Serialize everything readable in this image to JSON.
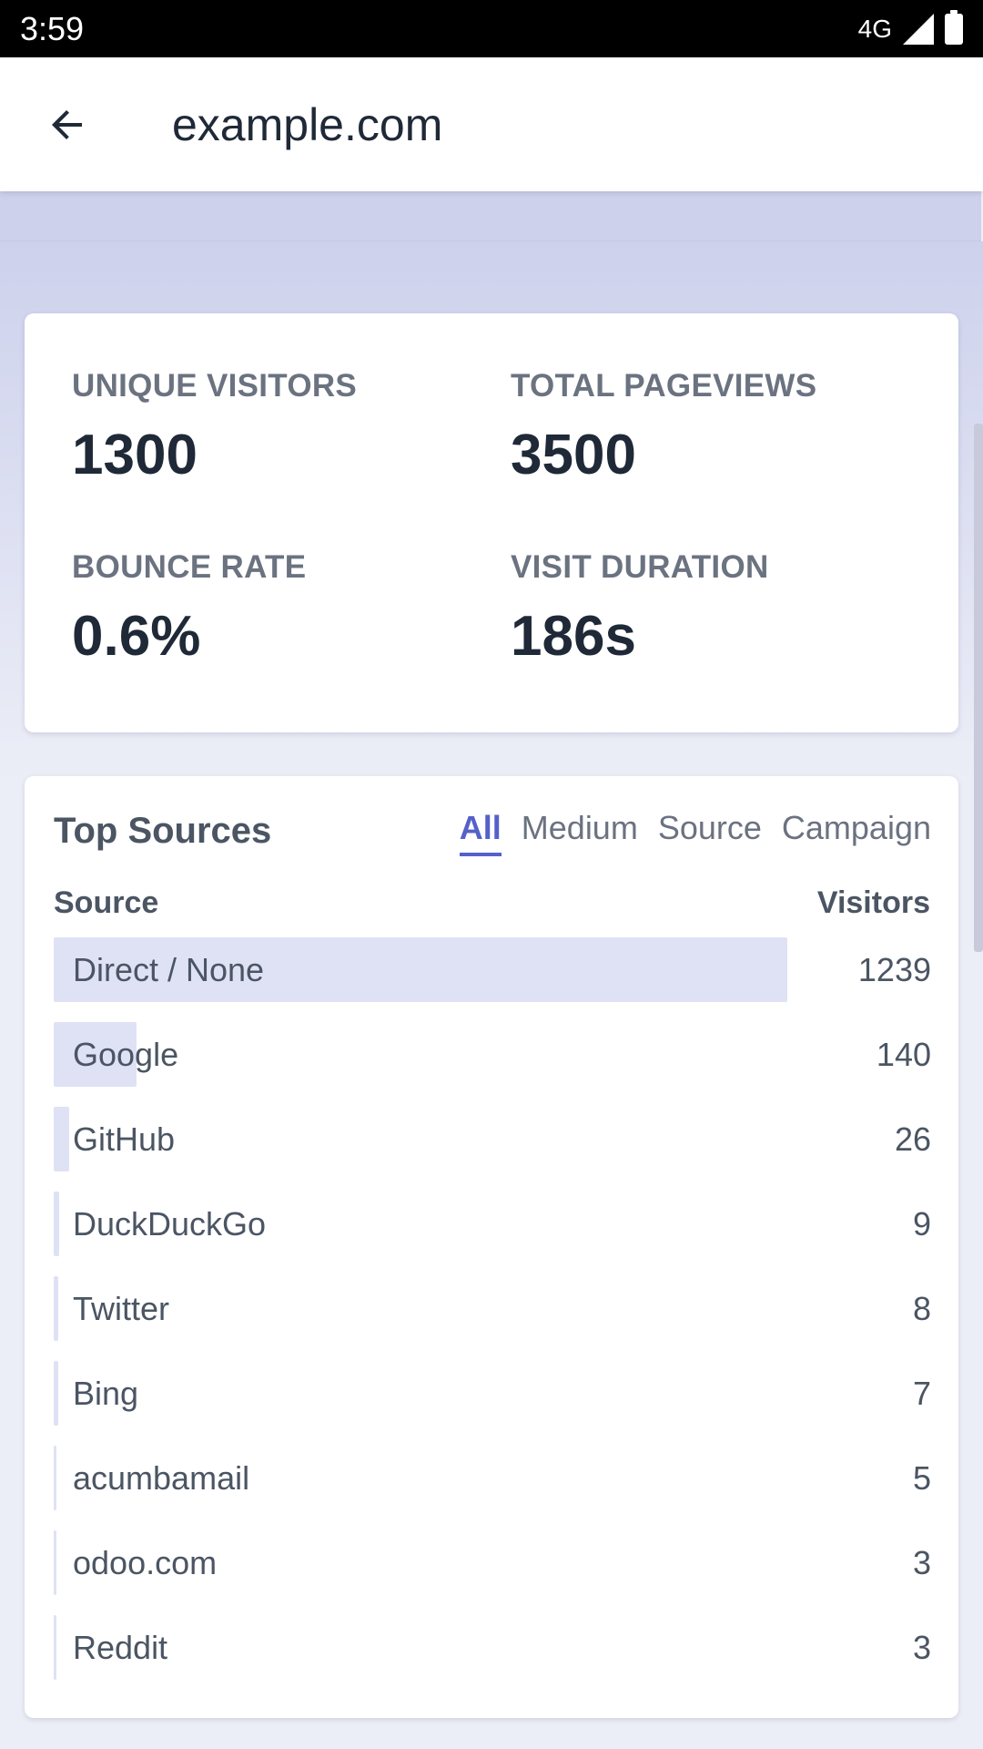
{
  "status": {
    "time": "3:59",
    "network": "4G"
  },
  "app_bar": {
    "title": "example.com"
  },
  "stats": [
    {
      "label": "UNIQUE VISITORS",
      "value": "1300"
    },
    {
      "label": "TOTAL PAGEVIEWS",
      "value": "3500"
    },
    {
      "label": "BOUNCE RATE",
      "value": "0.6%"
    },
    {
      "label": "VISIT DURATION",
      "value": "186s"
    }
  ],
  "sources": {
    "title": "Top Sources",
    "tabs": [
      "All",
      "Medium",
      "Source",
      "Campaign"
    ],
    "active_tab": "All",
    "columns": {
      "source": "Source",
      "visitors": "Visitors"
    },
    "rows": [
      {
        "label": "Direct / None",
        "value": "1239",
        "share": 1.0
      },
      {
        "label": "Google",
        "value": "140",
        "share": 0.113
      },
      {
        "label": "GitHub",
        "value": "26",
        "share": 0.021
      },
      {
        "label": "DuckDuckGo",
        "value": "9",
        "share": 0.007
      },
      {
        "label": "Twitter",
        "value": "8",
        "share": 0.0065
      },
      {
        "label": "Bing",
        "value": "7",
        "share": 0.0057
      },
      {
        "label": "acumbamail",
        "value": "5",
        "share": 0.004
      },
      {
        "label": "odoo.com",
        "value": "3",
        "share": 0.0024
      },
      {
        "label": "Reddit",
        "value": "3",
        "share": 0.0024
      }
    ]
  },
  "colors": {
    "accent": "#5561c9",
    "bar": "#dfe2f5",
    "header_strip": "#cdd1ec"
  }
}
